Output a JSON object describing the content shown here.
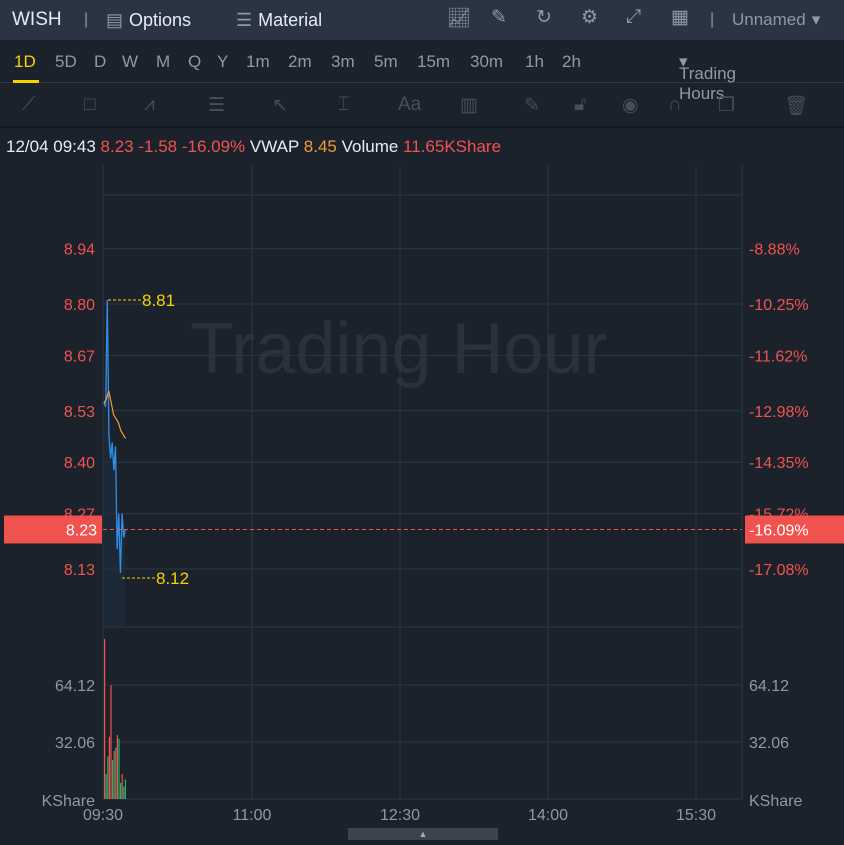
{
  "header": {
    "symbol": "WISH",
    "options": "Options",
    "material": "Material",
    "layout": "Unnamed",
    "icons": [
      "chart-present-icon",
      "edit-icon",
      "refresh-icon",
      "gear-icon",
      "fullscreen-icon",
      "grid-icon"
    ]
  },
  "periods": [
    "1D",
    "5D",
    "D",
    "W",
    "M",
    "Q",
    "Y",
    "1m",
    "2m",
    "3m",
    "5m",
    "15m",
    "30m",
    "1h",
    "2h"
  ],
  "active_period": "1D",
  "session": "Trading Hours",
  "tools": [
    "line-tool-icon",
    "rectangle-tool-icon",
    "pattern-tool-icon",
    "fib-tool-icon",
    "arrow-tool-icon",
    "measure-tool-icon",
    "text-tool-icon",
    "candle-tool-icon",
    "pen-icon",
    "lock-icon",
    "eye-icon",
    "magnet-icon",
    "layers-icon",
    "trash-icon"
  ],
  "info": {
    "datetime": "12/04 09:43",
    "price": "8.23",
    "change": "-1.58",
    "pct": "-16.09%",
    "vwap_label": "VWAP",
    "vwap": "8.45",
    "volume_label": "Volume",
    "volume": "11.65KShare"
  },
  "watermark": "Trading Hour",
  "colors": {
    "up": "#f0534f",
    "down": "#26b36b",
    "price_line": "#2f8fe8",
    "vwap_line": "#f29b30",
    "accent": "#f5d300"
  },
  "chart_data": {
    "type": "line",
    "price_axis_left": [
      "8.94",
      "8.80",
      "8.67",
      "8.53",
      "8.40",
      "8.27",
      "8.13"
    ],
    "price_axis_right": [
      "-8.88%",
      "-10.25%",
      "-11.62%",
      "-12.98%",
      "-14.35%",
      "-15.72%",
      "-17.08%"
    ],
    "price_ticks": [
      8.94,
      8.8,
      8.67,
      8.53,
      8.4,
      8.27,
      8.13
    ],
    "current_price": "8.23",
    "current_pct": "-16.09%",
    "high_label": "8.81",
    "low_label": "8.12",
    "x_ticks": [
      "09:30",
      "11:00",
      "12:30",
      "14:00",
      "15:30"
    ],
    "price": [
      8.55,
      8.54,
      8.81,
      8.47,
      8.41,
      8.45,
      8.38,
      8.44,
      8.18,
      8.27,
      8.12,
      8.27,
      8.21,
      8.23
    ],
    "vwap": [
      8.55,
      8.56,
      8.58,
      8.55,
      8.52,
      8.51,
      8.5,
      8.48,
      8.47,
      8.46
    ],
    "volume_axis": [
      "64.12",
      "32.06"
    ],
    "volume_unit": "KShare",
    "volume": [
      {
        "v": 90,
        "up": true
      },
      {
        "v": 14,
        "up": false
      },
      {
        "v": 24,
        "up": false
      },
      {
        "v": 35,
        "up": true
      },
      {
        "v": 64,
        "up": true
      },
      {
        "v": 22,
        "up": false
      },
      {
        "v": 27,
        "up": true
      },
      {
        "v": 29,
        "up": false
      },
      {
        "v": 36,
        "up": true
      },
      {
        "v": 34,
        "up": false
      },
      {
        "v": 9,
        "up": false
      },
      {
        "v": 14,
        "up": true
      },
      {
        "v": 7,
        "up": false
      },
      {
        "v": 11,
        "up": false
      }
    ]
  }
}
